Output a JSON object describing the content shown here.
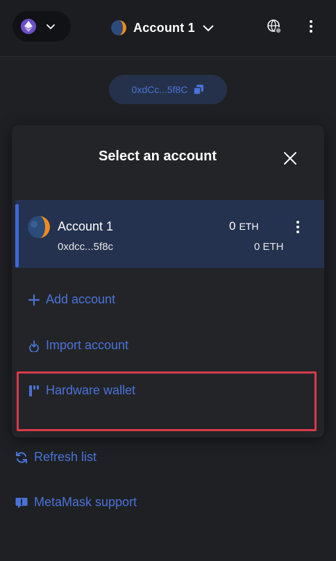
{
  "header": {
    "account_name": "Account 1"
  },
  "address_pill": {
    "address": "0xdCc...5f8C"
  },
  "modal": {
    "title": "Select an account",
    "account": {
      "name": "Account 1",
      "address": "0xdcc...5f8c",
      "balance_primary_value": "0",
      "balance_primary_unit": "ETH",
      "balance_secondary": "0 ETH"
    },
    "actions": {
      "add_account": "Add account",
      "import_account": "Import account",
      "hardware_wallet": "Hardware wallet"
    }
  },
  "footer": {
    "refresh": "Refresh list",
    "support": "MetaMask support"
  },
  "colors": {
    "background": "#1f2024",
    "accent": "#4a73d8",
    "selected_row": "#24324f",
    "highlight": "#d83a4a"
  }
}
